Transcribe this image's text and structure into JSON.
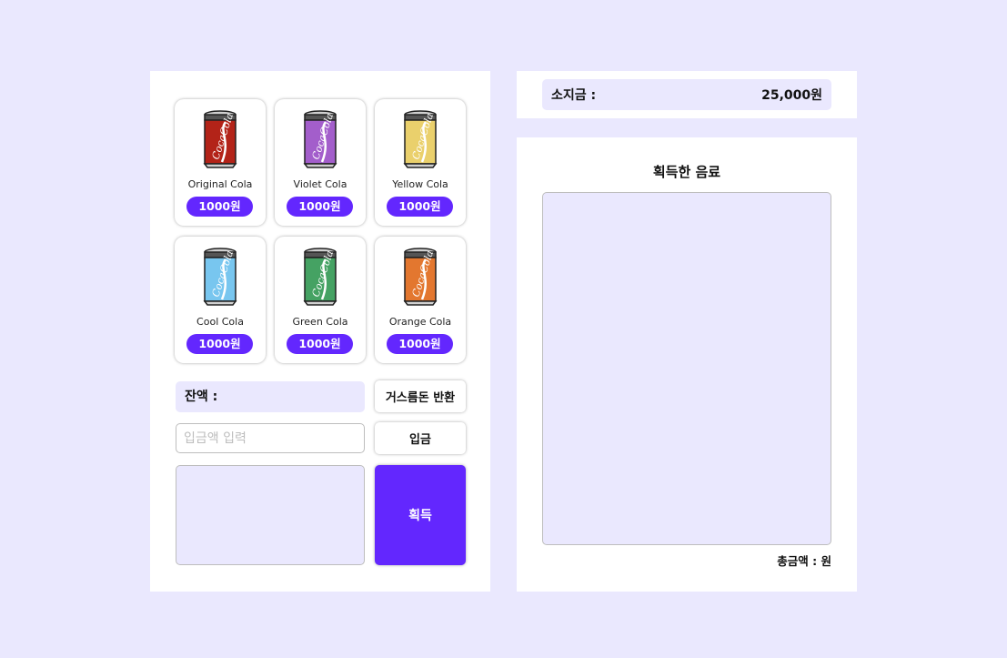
{
  "products": [
    {
      "name": "Original Cola",
      "price": "1000원",
      "color": "#b32318"
    },
    {
      "name": "Violet Cola",
      "price": "1000원",
      "color": "#a35ecb"
    },
    {
      "name": "Yellow Cola",
      "price": "1000원",
      "color": "#ead06c"
    },
    {
      "name": "Cool Cola",
      "price": "1000원",
      "color": "#78c6ef"
    },
    {
      "name": "Green Cola",
      "price": "1000원",
      "color": "#45a263"
    },
    {
      "name": "Orange Cola",
      "price": "1000원",
      "color": "#e3772f"
    }
  ],
  "can_logo": "CocaCola",
  "vending": {
    "balance_label": "잔액 :",
    "return_button": "거스름돈 반환",
    "deposit_placeholder": "입금액 입력",
    "deposit_button": "입금",
    "acquire_button": "획득"
  },
  "wallet": {
    "label": "소지금 :",
    "amount": "25,000원"
  },
  "acquired": {
    "title": "획득한 음료",
    "total_label": "총금액 : 원"
  },
  "colors": {
    "accent": "#6327fe",
    "background": "#eae8fe"
  }
}
